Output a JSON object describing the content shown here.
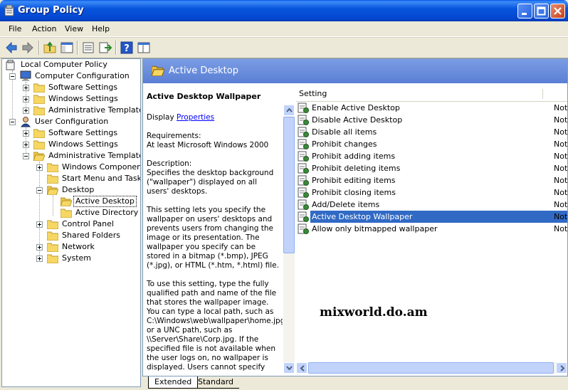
{
  "window": {
    "title": "Group Policy"
  },
  "menu": [
    {
      "label": "File"
    },
    {
      "label": "Action"
    },
    {
      "label": "View"
    },
    {
      "label": "Help"
    }
  ],
  "toolbar": {
    "icons": [
      "back-icon",
      "forward-icon",
      "up-folder-icon",
      "show-hide-tree-icon",
      "properties-icon",
      "export-list-icon",
      "help-icon",
      "console-view-icon"
    ]
  },
  "tree": {
    "root": "Local Computer Policy",
    "computer_configuration": "Computer Configuration",
    "cc_software_settings": "Software Settings",
    "cc_windows_settings": "Windows Settings",
    "cc_administrative_templates": "Administrative Templates",
    "user_configuration": "User Configuration",
    "uc_software_settings": "Software Settings",
    "uc_windows_settings": "Windows Settings",
    "uc_administrative_templates": "Administrative Templates",
    "windows_components": "Windows Components",
    "start_menu_taskbar": "Start Menu and Taskba",
    "desktop": "Desktop",
    "active_desktop": "Active Desktop",
    "active_directory": "Active Directory",
    "control_panel": "Control Panel",
    "shared_folders": "Shared Folders",
    "network": "Network",
    "system": "System"
  },
  "header": {
    "title": "Active Desktop"
  },
  "extended": {
    "policy_title": "Active Desktop Wallpaper",
    "display_prefix": "Display ",
    "properties_link": "Properties",
    "body": "\n\nRequirements:\nAt least Microsoft Windows 2000\n\nDescription:\nSpecifies the desktop background (\"wallpaper\") displayed on all users' desktops.\n\nThis setting lets you specify the wallpaper on users' desktops and prevents users from changing the image or its presentation. The wallpaper you specify can be stored in a bitmap (*.bmp), JPEG (*.jpg), or HTML (*.htm, *.html) file.\n\nTo use this setting, type the fully qualified path and name of the file that stores the wallpaper image. You can type a local path, such as C:\\Windows\\web\\wallpaper\\home.jpg or a UNC path, such as \\\\Server\\Share\\Corp.jpg. If the specified file is not available when the user logs on, no wallpaper is displayed. Users cannot specify"
  },
  "list": {
    "column_setting": "Setting",
    "rows": [
      {
        "name": "Enable Active Desktop",
        "state": "Not"
      },
      {
        "name": "Disable Active Desktop",
        "state": "Not"
      },
      {
        "name": "Disable all items",
        "state": "Not"
      },
      {
        "name": "Prohibit changes",
        "state": "Not"
      },
      {
        "name": "Prohibit adding items",
        "state": "Not"
      },
      {
        "name": "Prohibit deleting items",
        "state": "Not"
      },
      {
        "name": "Prohibit editing items",
        "state": "Not"
      },
      {
        "name": "Prohibit closing items",
        "state": "Not"
      },
      {
        "name": "Add/Delete items",
        "state": "Not"
      },
      {
        "name": "Active Desktop Wallpaper",
        "state": "Not",
        "selected": true
      },
      {
        "name": "Allow only bitmapped wallpaper",
        "state": "Not"
      }
    ]
  },
  "watermark": "mixworld.do.am",
  "tabs": [
    {
      "label": "Extended",
      "active": true
    },
    {
      "label": "Standard",
      "active": false
    }
  ],
  "colors": {
    "titlebar": "#0446cf",
    "selection": "#316ac5",
    "header": "#5a7fd4",
    "link": "#0000ff"
  }
}
